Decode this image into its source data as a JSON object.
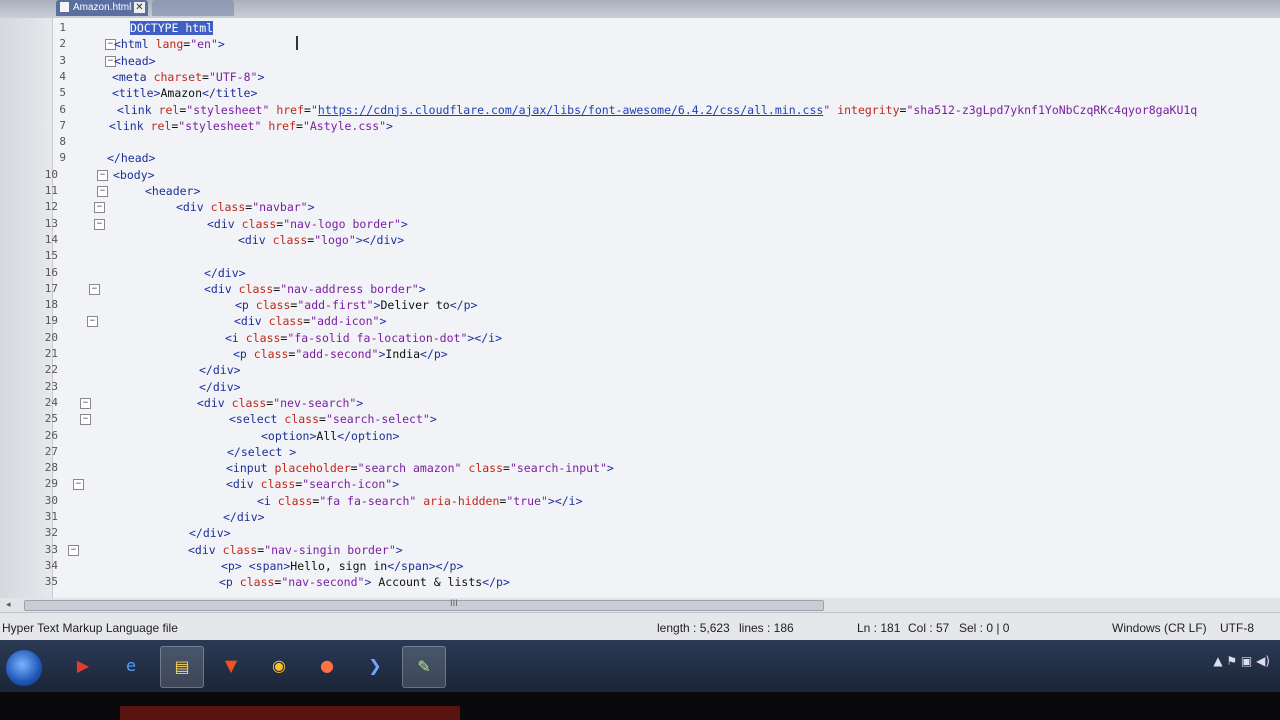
{
  "tabs": [
    {
      "label": "Amazon.html",
      "close_glyph": "✕"
    },
    {
      "label": ""
    }
  ],
  "lines": [
    {
      "n": "1",
      "fold": "",
      "html": "<span class='sel'>DOCTYPE html</span>",
      "indent": 130
    },
    {
      "n": "2",
      "fold": "⊟",
      "html": "<span class='tag'>&lt;html</span> <span class='attr'>lang</span>=<span class='str'>\"en\"</span><span class='tag'>&gt;</span>",
      "indent": 114
    },
    {
      "n": "3",
      "fold": "⊟",
      "html": "<span class='tag'>&lt;head&gt;</span>",
      "indent": 114
    },
    {
      "n": "4",
      "fold": "",
      "html": "<span class='tag'>&lt;meta</span> <span class='attr'>charset</span>=<span class='str'>\"UTF-8\"</span><span class='tag'>&gt;</span>",
      "indent": 112
    },
    {
      "n": "5",
      "fold": "",
      "html": "<span class='tag'>&lt;title&gt;</span>Amazon<span class='tag'>&lt;/title&gt;</span>",
      "indent": 112
    },
    {
      "n": "6",
      "fold": "",
      "html": "<span class='tag'>&lt;link</span> <span class='attr'>rel</span>=<span class='str'>\"stylesheet\"</span> <span class='attr'>href</span>=<span class='str'>\"</span><span class='url'>https://cdnjs.cloudflare.com/ajax/libs/font-awesome/6.4.2/css/all.min.css</span><span class='str'>\"</span> <span class='attr'>integrity</span>=<span class='str'>\"sha512-z3gLpd7yknf1YoNbCzqRKc4qyor8gaKU1q</span>",
      "indent": 117
    },
    {
      "n": "7",
      "fold": "",
      "html": "<span class='tag'>&lt;link</span> <span class='attr'>rel</span>=<span class='str'>\"stylesheet\"</span> <span class='attr'>href</span>=<span class='str'>\"Astyle.css\"</span><span class='tag'>&gt;</span>",
      "indent": 109
    },
    {
      "n": "8",
      "fold": "",
      "html": "",
      "indent": 109
    },
    {
      "n": "9",
      "fold": "",
      "html": "<span class='tag'>&lt;/head&gt;</span>",
      "indent": 107
    },
    {
      "n": "10",
      "fold": "⊟",
      "html": "<span class='tag'>&lt;body&gt;</span>",
      "indent": 113
    },
    {
      "n": "11",
      "fold": "⊟",
      "html": "<span class='tag'>&lt;header&gt;</span>",
      "indent": 145
    },
    {
      "n": "12",
      "fold": "⊟",
      "html": "<span class='tag'>&lt;div</span> <span class='attr'>class</span>=<span class='str'>\"navbar\"</span><span class='tag'>&gt;</span>",
      "indent": 176
    },
    {
      "n": "13",
      "fold": "⊟",
      "html": "<span class='tag'>&lt;div</span> <span class='attr'>class</span>=<span class='str'>\"nav-logo border\"</span><span class='tag'>&gt;</span>",
      "indent": 207
    },
    {
      "n": "14",
      "fold": "",
      "html": "<span class='tag'>&lt;div</span> <span class='attr'>class</span>=<span class='str'>\"logo\"</span><span class='tag'>&gt;&lt;/div&gt;</span>",
      "indent": 238
    },
    {
      "n": "15",
      "fold": "",
      "html": "",
      "indent": 238
    },
    {
      "n": "16",
      "fold": "",
      "html": "<span class='tag'>&lt;/div&gt;</span>",
      "indent": 204
    },
    {
      "n": "17",
      "fold": "⊟",
      "html": "<span class='tag'>&lt;div</span> <span class='attr'>class</span>=<span class='str'>\"nav-address border\"</span><span class='tag'>&gt;</span>",
      "indent": 204
    },
    {
      "n": "18",
      "fold": "",
      "html": "<span class='tag'>&lt;p</span> <span class='attr'>class</span>=<span class='str'>\"add-first\"</span><span class='tag'>&gt;</span>Deliver to<span class='tag'>&lt;/p&gt;</span>",
      "indent": 235
    },
    {
      "n": "19",
      "fold": "⊟",
      "html": "<span class='tag'>&lt;div</span> <span class='attr'>class</span>=<span class='str'>\"add-icon\"</span><span class='tag'>&gt;</span>",
      "indent": 234
    },
    {
      "n": "20",
      "fold": "",
      "html": "<span class='tag'>&lt;i</span> <span class='attr'>class</span>=<span class='str'>\"fa-solid fa-location-dot\"</span><span class='tag'>&gt;&lt;/i&gt;</span>",
      "indent": 225
    },
    {
      "n": "21",
      "fold": "",
      "html": "<span class='tag'>&lt;p</span> <span class='attr'>class</span>=<span class='str'>\"add-second\"</span><span class='tag'>&gt;</span>India<span class='tag'>&lt;/p&gt;</span>",
      "indent": 233
    },
    {
      "n": "22",
      "fold": "",
      "html": "<span class='tag'>&lt;/div&gt;</span>",
      "indent": 199
    },
    {
      "n": "23",
      "fold": "",
      "html": "<span class='tag'>&lt;/div&gt;</span>",
      "indent": 199
    },
    {
      "n": "24",
      "fold": "⊟",
      "html": "<span class='tag'>&lt;div</span> <span class='attr'>class</span>=<span class='str'>\"nev-search\"</span><span class='tag'>&gt;</span>",
      "indent": 197
    },
    {
      "n": "25",
      "fold": "⊟",
      "html": "<span class='tag'>&lt;select</span> <span class='attr'>class</span>=<span class='str'>\"search-select\"</span><span class='tag'>&gt;</span>",
      "indent": 229
    },
    {
      "n": "26",
      "fold": "",
      "html": "<span class='tag'>&lt;option&gt;</span>All<span class='tag'>&lt;/option&gt;</span>",
      "indent": 261
    },
    {
      "n": "27",
      "fold": "",
      "html": "<span class='tag'>&lt;/select &gt;</span>",
      "indent": 227
    },
    {
      "n": "28",
      "fold": "",
      "html": "<span class='tag'>&lt;input</span> <span class='attr'>placeholder</span>=<span class='str'>\"search amazon\"</span> <span class='attr'>class</span>=<span class='str'>\"search-input\"</span><span class='tag'>&gt;</span>",
      "indent": 226
    },
    {
      "n": "29",
      "fold": "⊟",
      "html": "<span class='tag'>&lt;div</span> <span class='attr'>class</span>=<span class='str'>\"search-icon\"</span><span class='tag'>&gt;</span>",
      "indent": 226
    },
    {
      "n": "30",
      "fold": "",
      "html": "<span class='tag'>&lt;i</span> <span class='attr'>class</span>=<span class='str'>\"fa fa-search\"</span> <span class='attr'>aria-hidden</span>=<span class='str'>\"true\"</span><span class='tag'>&gt;&lt;/i&gt;</span>",
      "indent": 257
    },
    {
      "n": "31",
      "fold": "",
      "html": "<span class='tag'>&lt;/div&gt;</span>",
      "indent": 223
    },
    {
      "n": "32",
      "fold": "",
      "html": "<span class='tag'>&lt;/div&gt;</span>",
      "indent": 189
    },
    {
      "n": "33",
      "fold": "⊟",
      "html": "<span class='tag'>&lt;div</span> <span class='attr'>class</span>=<span class='str'>\"nav-singin border\"</span><span class='tag'>&gt;</span>",
      "indent": 188
    },
    {
      "n": "34",
      "fold": "",
      "html": "<span class='tag'>&lt;p&gt;</span> <span class='tag'>&lt;span&gt;</span>Hello, sign in<span class='tag'>&lt;/span&gt;&lt;/p&gt;</span>",
      "indent": 221
    },
    {
      "n": "35",
      "fold": "",
      "html": "<span class='tag'>&lt;p</span> <span class='attr'>class</span>=<span class='str'>\"nav-second\"</span><span class='tag'>&gt;</span> Account &amp; lists<span class='tag'>&lt;/p&gt;</span>",
      "indent": 219
    }
  ],
  "scroll": {
    "grip": "III"
  },
  "status": {
    "filetype": "Hyper Text Markup Language file",
    "length": "length : 5,623",
    "lines": "lines : 186",
    "ln": "Ln : 181",
    "col": "Col : 57",
    "sel": "Sel : 0 | 0",
    "eol": "Windows (CR LF)",
    "encoding": "UTF-8"
  },
  "taskbar": {
    "apps": [
      {
        "name": "youtube-app",
        "glyph": "▶",
        "color": "#e53935"
      },
      {
        "name": "ie-app",
        "glyph": "e",
        "color": "#4fa3ff"
      },
      {
        "name": "explorer-app",
        "glyph": "▤",
        "color": "#f5d36b"
      },
      {
        "name": "brave-app",
        "glyph": "▼",
        "color": "#f4511e"
      },
      {
        "name": "chrome-app",
        "glyph": "◉",
        "color": "#fbc02d"
      },
      {
        "name": "firefox-app",
        "glyph": "●",
        "color": "#ff7043"
      },
      {
        "name": "vscode-app",
        "glyph": "❯",
        "color": "#6fa8ff"
      },
      {
        "name": "notepadpp-app",
        "glyph": "✎",
        "color": "#b8e986"
      }
    ],
    "tray": "▲  ⚑  ▣  ◀)"
  }
}
